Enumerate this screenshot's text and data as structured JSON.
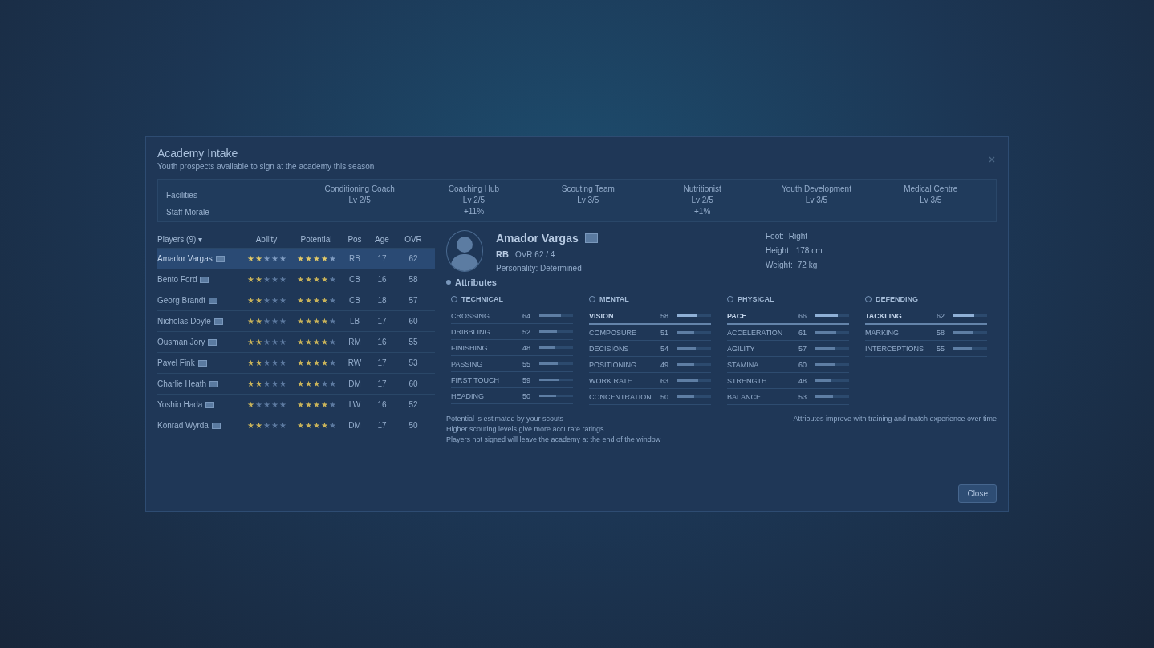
{
  "dialog": {
    "title": "Academy Intake",
    "subtitle": "Youth prospects available to sign at the academy this season"
  },
  "facilities": {
    "labels": [
      "Facilities",
      "Staff Morale"
    ],
    "stats": [
      {
        "label": "Conditioning Coach",
        "value": "Lv 2/5"
      },
      {
        "label": "Coaching Hub",
        "value": "Lv 2/5",
        "note": "+11%"
      },
      {
        "label": "Scouting Team",
        "value": "Lv 3/5"
      },
      {
        "label": "Nutritionist",
        "value": "Lv 2/5",
        "note": "+1%"
      },
      {
        "label": "Youth Development",
        "value": "Lv 3/5"
      },
      {
        "label": "Medical Centre",
        "value": "Lv 3/5"
      }
    ]
  },
  "players_table": {
    "columns": [
      "Players (9) ▾",
      "Ability",
      "Potential",
      "Pos",
      "Age",
      "OVR"
    ],
    "rows": [
      {
        "name": "Amador Vargas",
        "selected": true,
        "ability": {
          "stars": 2
        },
        "potential": {
          "stars": 4
        },
        "pos": "RB",
        "age": "17",
        "ovr": "62"
      },
      {
        "name": "Bento Ford",
        "selected": false,
        "ability": {
          "stars": 2
        },
        "potential": {
          "stars": 4
        },
        "pos": "CB",
        "age": "16",
        "ovr": "58"
      },
      {
        "name": "Georg Brandt",
        "selected": false,
        "ability": {
          "stars": 2
        },
        "potential": {
          "stars": 4
        },
        "pos": "CB",
        "age": "18",
        "ovr": "57"
      },
      {
        "name": "Nicholas Doyle",
        "selected": false,
        "ability": {
          "stars": 2
        },
        "potential": {
          "stars": 4
        },
        "pos": "LB",
        "age": "17",
        "ovr": "60"
      },
      {
        "name": "Ousman Jory",
        "selected": false,
        "ability": {
          "stars": 2
        },
        "potential": {
          "stars": 4
        },
        "pos": "RM",
        "age": "16",
        "ovr": "55"
      },
      {
        "name": "Pavel Fink",
        "selected": false,
        "ability": {
          "stars": 2
        },
        "potential": {
          "stars": 4
        },
        "pos": "RW",
        "age": "17",
        "ovr": "53"
      },
      {
        "name": "Charlie Heath",
        "selected": false,
        "ability": {
          "stars": 2
        },
        "potential": {
          "stars": 3
        },
        "pos": "DM",
        "age": "17",
        "ovr": "60"
      },
      {
        "name": "Yoshio Hada",
        "selected": false,
        "ability": {
          "stars": 1
        },
        "potential": {
          "stars": 4
        },
        "pos": "LW",
        "age": "16",
        "ovr": "52"
      },
      {
        "name": "Konrad Wyrda",
        "selected": false,
        "ability": {
          "stars": 2
        },
        "potential": {
          "stars": 4
        },
        "pos": "DM",
        "age": "17",
        "ovr": "50"
      }
    ]
  },
  "profile": {
    "name": "Amador Vargas",
    "position": "RB",
    "rating": "OVR 62 / 4",
    "personality": "Personality: Determined",
    "details": [
      {
        "label": "Foot:",
        "value": "Right"
      },
      {
        "label": "Height:",
        "value": "178 cm"
      },
      {
        "label": "Weight:",
        "value": "72 kg"
      }
    ]
  },
  "attributes": {
    "heading": "Attributes",
    "groups": [
      {
        "title": "TECHNICAL",
        "items": [
          {
            "name": "CROSSING",
            "value": "64",
            "level": 0.64,
            "selected": false
          },
          {
            "name": "DRIBBLING",
            "value": "52",
            "level": 0.52,
            "selected": false
          },
          {
            "name": "FINISHING",
            "value": "48",
            "level": 0.48,
            "selected": false
          },
          {
            "name": "PASSING",
            "value": "55",
            "level": 0.55,
            "selected": false
          },
          {
            "name": "FIRST TOUCH",
            "value": "59",
            "level": 0.59,
            "selected": false
          },
          {
            "name": "HEADING",
            "value": "50",
            "level": 0.5,
            "selected": false
          }
        ]
      },
      {
        "title": "MENTAL",
        "items": [
          {
            "name": "VISION",
            "value": "58",
            "level": 0.58,
            "selected": true
          },
          {
            "name": "COMPOSURE",
            "value": "51",
            "level": 0.51,
            "selected": false
          },
          {
            "name": "DECISIONS",
            "value": "54",
            "level": 0.54,
            "selected": false
          },
          {
            "name": "POSITIONING",
            "value": "49",
            "level": 0.49,
            "selected": false
          },
          {
            "name": "WORK RATE",
            "value": "63",
            "level": 0.63,
            "selected": false
          },
          {
            "name": "CONCENTRATION",
            "value": "50",
            "level": 0.5,
            "selected": false
          }
        ]
      },
      {
        "title": "PHYSICAL",
        "items": [
          {
            "name": "PACE",
            "value": "66",
            "level": 0.66,
            "selected": true
          },
          {
            "name": "ACCELERATION",
            "value": "61",
            "level": 0.61,
            "selected": false
          },
          {
            "name": "AGILITY",
            "value": "57",
            "level": 0.57,
            "selected": false
          },
          {
            "name": "STAMINA",
            "value": "60",
            "level": 0.6,
            "selected": false
          },
          {
            "name": "STRENGTH",
            "value": "48",
            "level": 0.48,
            "selected": false
          },
          {
            "name": "BALANCE",
            "value": "53",
            "level": 0.53,
            "selected": false
          }
        ]
      },
      {
        "title": "DEFENDING",
        "items": [
          {
            "name": "TACKLING",
            "value": "62",
            "level": 0.62,
            "selected": true
          },
          {
            "name": "MARKING",
            "value": "58",
            "level": 0.58,
            "selected": false
          },
          {
            "name": "INTERCEPTIONS",
            "value": "55",
            "level": 0.55,
            "selected": false
          }
        ]
      }
    ]
  },
  "notes": [
    "Potential is estimated by your scouts",
    "Higher scouting levels give more accurate ratings",
    "Players not signed will leave the academy at the end of the window"
  ],
  "side_note": "Attributes improve with training and match experience over time",
  "buttons": [
    "Close"
  ]
}
